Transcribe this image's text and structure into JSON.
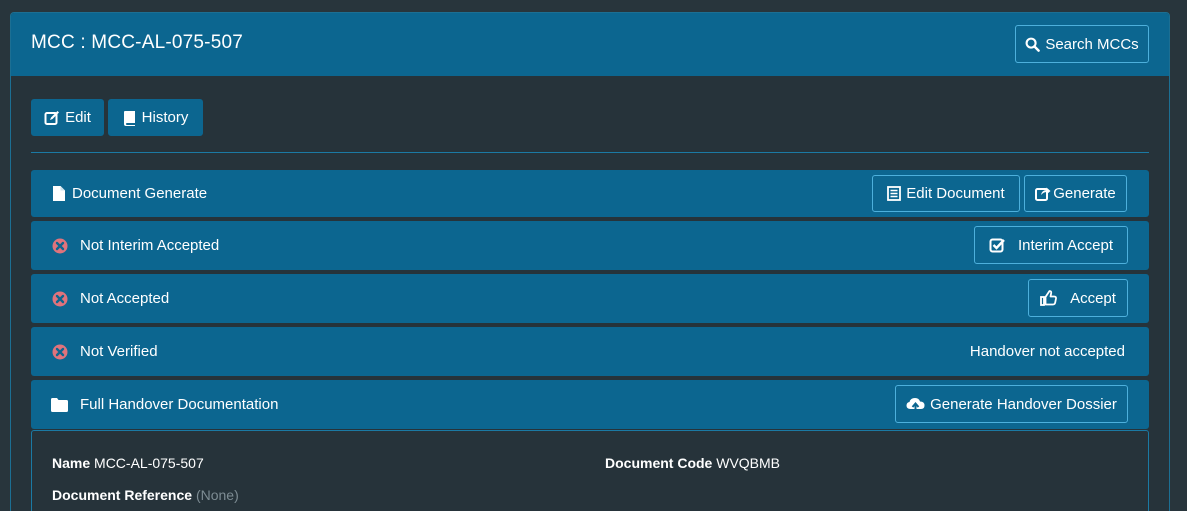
{
  "header": {
    "title": "MCC : MCC-AL-075-507",
    "search_button": "Search MCCs"
  },
  "toolbar": {
    "edit_label": "Edit",
    "history_label": "History"
  },
  "rows": {
    "document_generate": {
      "label": "Document Generate",
      "edit_document_button": "Edit Document",
      "generate_button": "Generate"
    },
    "interim": {
      "label": "Not Interim Accepted",
      "button": "Interim Accept"
    },
    "accepted": {
      "label": "Not Accepted",
      "button": "Accept"
    },
    "verified": {
      "label": "Not Verified",
      "status": "Handover not accepted"
    },
    "handover": {
      "label": "Full Handover Documentation",
      "button": "Generate Handover Dossier"
    }
  },
  "details": {
    "name_label": "Name",
    "name_value": "MCC-AL-075-507",
    "code_label": "Document Code",
    "code_value": "WVQBMB",
    "reference_label": "Document Reference",
    "reference_value": "(None)"
  },
  "colors": {
    "header_bg": "#0c6690",
    "row_bg": "#0c6690",
    "page_bg": "#26333a",
    "error_icon": "#e0737c",
    "border_accent": "#4db0dc"
  },
  "icons": [
    "search-icon",
    "edit-icon",
    "book-icon",
    "file-icon",
    "list-icon",
    "share-icon",
    "x-circle-icon",
    "check-square-icon",
    "thumbs-up-icon",
    "folder-icon",
    "cloud-upload-icon"
  ]
}
